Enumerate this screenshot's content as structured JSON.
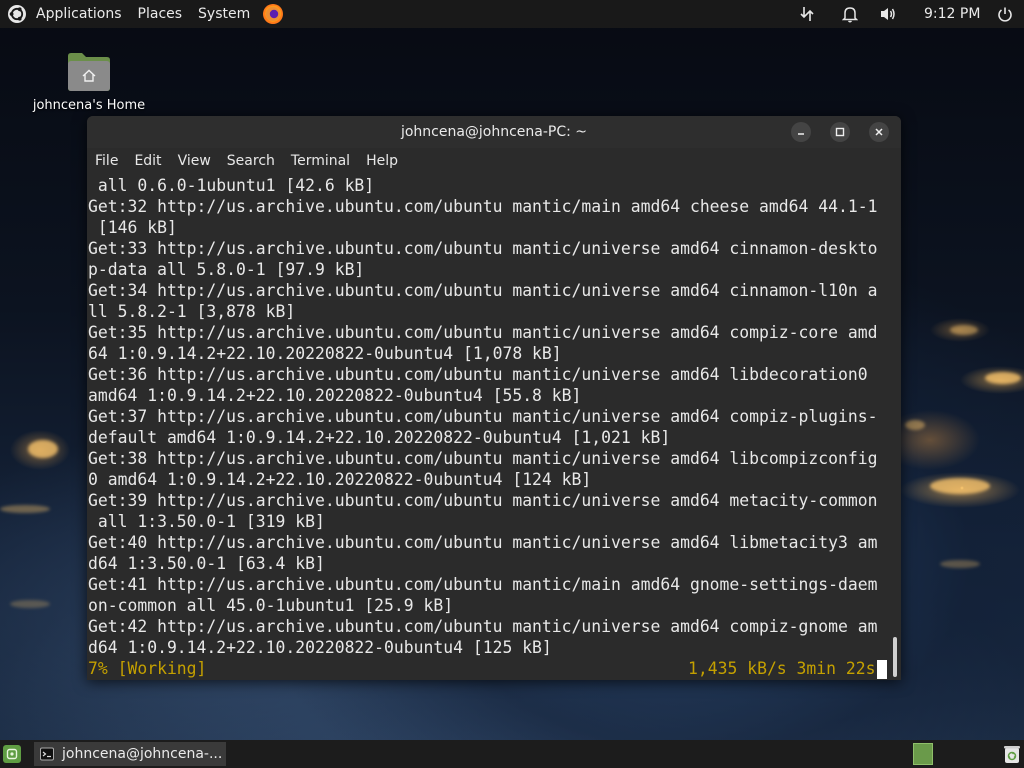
{
  "top_panel": {
    "menus": [
      "Applications",
      "Places",
      "System"
    ],
    "clock": "9:12 PM",
    "icons": {
      "apps_logo": "ubuntu-logo-icon",
      "browser": "firefox-icon",
      "network": "network-icon",
      "notifications": "bell-icon",
      "volume": "volume-icon",
      "power": "power-icon"
    }
  },
  "desktop": {
    "home_icon_label": "johncena's Home",
    "home_icon": "home-folder-icon"
  },
  "terminal": {
    "title": "johncena@johncena-PC: ~",
    "menu": [
      "File",
      "Edit",
      "View",
      "Search",
      "Terminal",
      "Help"
    ],
    "lines": [
      " all 0.6.0-1ubuntu1 [42.6 kB]",
      "Get:32 http://us.archive.ubuntu.com/ubuntu mantic/main amd64 cheese amd64 44.1-1",
      " [146 kB]",
      "Get:33 http://us.archive.ubuntu.com/ubuntu mantic/universe amd64 cinnamon-deskto",
      "p-data all 5.8.0-1 [97.9 kB]",
      "Get:34 http://us.archive.ubuntu.com/ubuntu mantic/universe amd64 cinnamon-l10n a",
      "ll 5.8.2-1 [3,878 kB]",
      "Get:35 http://us.archive.ubuntu.com/ubuntu mantic/universe amd64 compiz-core amd",
      "64 1:0.9.14.2+22.10.20220822-0ubuntu4 [1,078 kB]",
      "Get:36 http://us.archive.ubuntu.com/ubuntu mantic/universe amd64 libdecoration0 ",
      "amd64 1:0.9.14.2+22.10.20220822-0ubuntu4 [55.8 kB]",
      "Get:37 http://us.archive.ubuntu.com/ubuntu mantic/universe amd64 compiz-plugins-",
      "default amd64 1:0.9.14.2+22.10.20220822-0ubuntu4 [1,021 kB]",
      "Get:38 http://us.archive.ubuntu.com/ubuntu mantic/universe amd64 libcompizconfig",
      "0 amd64 1:0.9.14.2+22.10.20220822-0ubuntu4 [124 kB]",
      "Get:39 http://us.archive.ubuntu.com/ubuntu mantic/universe amd64 metacity-common",
      " all 1:3.50.0-1 [319 kB]",
      "Get:40 http://us.archive.ubuntu.com/ubuntu mantic/universe amd64 libmetacity3 am",
      "d64 1:3.50.0-1 [63.4 kB]",
      "Get:41 http://us.archive.ubuntu.com/ubuntu mantic/main amd64 gnome-settings-daem",
      "on-common all 45.0-1ubuntu1 [25.9 kB]",
      "Get:42 http://us.archive.ubuntu.com/ubuntu mantic/universe amd64 compiz-gnome am",
      "d64 1:0.9.14.2+22.10.20220822-0ubuntu4 [125 kB]"
    ],
    "status_left": "7% [Working]",
    "status_right": "1,435 kB/s 3min 22s",
    "status_color": "#c4a000"
  },
  "bottom_panel": {
    "taskbar_item": "johncena@johncena-...",
    "icons": {
      "menu": "mint-menu-icon",
      "terminal": "terminal-icon",
      "workspace": "workspace-switcher-icon",
      "trash": "trash-icon"
    }
  }
}
